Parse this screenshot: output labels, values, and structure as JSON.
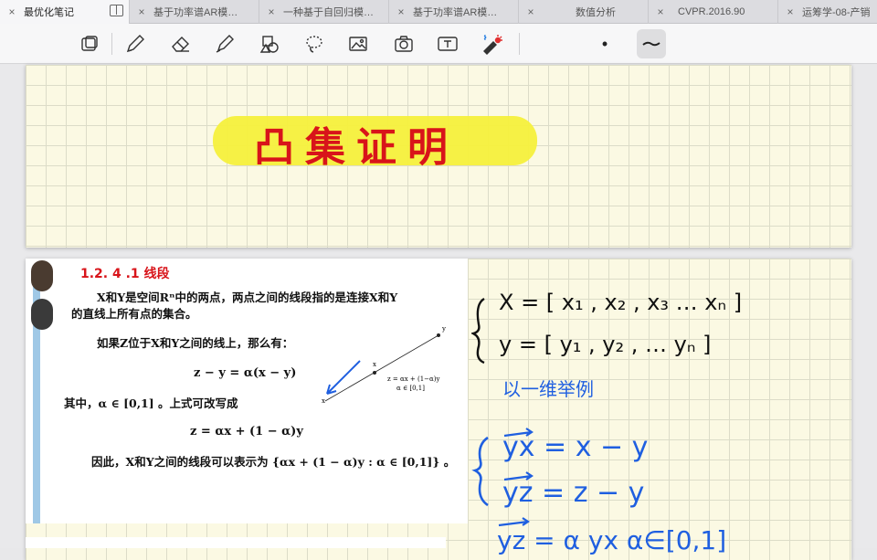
{
  "tabs": [
    {
      "label": "最优化笔记",
      "active": true
    },
    {
      "label": "基于功率谱AR模…",
      "active": false
    },
    {
      "label": "一种基于自回归模…",
      "active": false
    },
    {
      "label": "基于功率谱AR模…",
      "active": false
    },
    {
      "label": "数值分析",
      "active": false
    },
    {
      "label": "CVPR.2016.90",
      "active": false
    },
    {
      "label": "运筹学-08-产销",
      "active": false
    }
  ],
  "toolbar": {
    "tools": [
      "page-view-icon",
      "pen-icon",
      "eraser-icon",
      "highlighter-icon",
      "shapes-icon",
      "lasso-icon",
      "image-icon",
      "camera-icon",
      "textbox-icon",
      "laser-pointer-icon"
    ],
    "pen_color_dot": "•",
    "stroke_style_selected": true
  },
  "page1": {
    "title": "凸集证明",
    "title_color": "#d8141a",
    "highlight_color": "#f6f03c"
  },
  "excerpt": {
    "heading": "1.2. 4 .1  线段",
    "para1_line1": "X和Y是空间Rⁿ中的两点，两点之间的线段指的是连接X和Y",
    "para1_line2": "的直线上所有点的集合。",
    "para2": "如果Z位于X和Y之间的线上，那么有：",
    "eq1": "z − y = α(x − y)",
    "para3": "其中，α ∈ [0,1] 。上式可改写成",
    "eq2": "z = αx + (1 − α)y",
    "para4": "因此，X和Y之间的线段可以表示为 {αx + (1 − α)y : α ∈ [0,1]}  。",
    "diagram_labels": {
      "y": "y",
      "x": "x",
      "z_eq": "z = αx + (1−α)y",
      "alpha_range": "α ∈ [0,1]",
      "x_near": "x"
    }
  },
  "handwriting": {
    "line1": "X = [ x₁ , x₂ , x₃  … xₙ ]",
    "line2": "y = [ y₁ , y₂ , …    yₙ ]",
    "line3": "以一维举例",
    "line4": "yx = x − y",
    "line5": "yz = z − y",
    "line6": "yz = α yx   α∈[0,1]",
    "black": "#111111",
    "blue": "#1f5fe0"
  }
}
